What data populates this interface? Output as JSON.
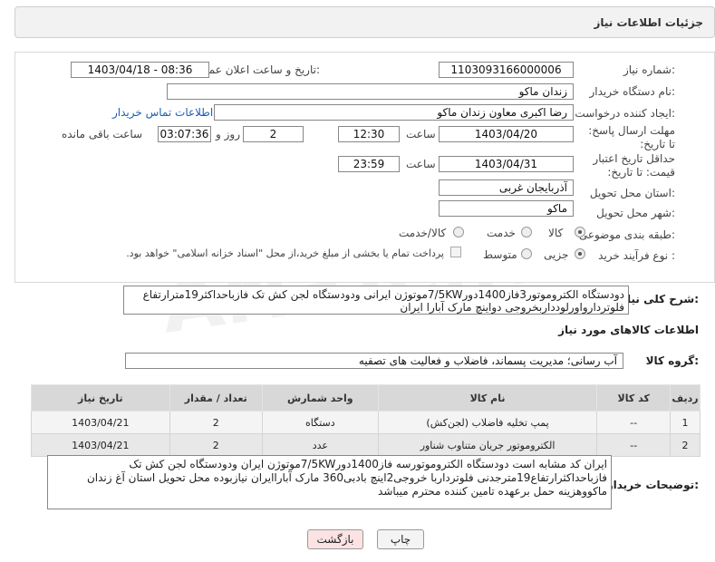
{
  "header": {
    "title": "جزئیات اطلاعات نیاز"
  },
  "watermark": "AriaTender.net",
  "form": {
    "need_number": {
      "label": "شماره نیاز:",
      "value": "1103093166000006"
    },
    "announce_datetime": {
      "label": "تاریخ و ساعت اعلان عمومی:",
      "value": "1403/04/18 - 08:36"
    },
    "buyer_org": {
      "label": "نام دستگاه خریدار:",
      "value": "زندان ماکو"
    },
    "requester": {
      "label": "ایجاد کننده درخواست:",
      "value": "رضا اکبری معاون زندان ماکو",
      "contact_link": "اطلاعات تماس خریدار"
    },
    "deadline": {
      "label": "مهلت ارسال پاسخ: تا تاریخ:",
      "date": "1403/04/20",
      "time_label": "ساعت",
      "time": "12:30",
      "days": "2",
      "days_label": "روز و",
      "remaining": "03:07:36",
      "remaining_label": "ساعت باقی مانده"
    },
    "validity": {
      "label": "حداقل تاریخ اعتبار قیمت: تا تاریخ:",
      "date": "1403/04/31",
      "time_label": "ساعت",
      "time": "23:59"
    },
    "province": {
      "label": "استان محل تحویل:",
      "value": "آذربایجان غربی"
    },
    "city": {
      "label": "شهر محل تحویل:",
      "value": "ماکو"
    },
    "category": {
      "label": "طبقه بندی موضوعی:",
      "options": [
        "کالا",
        "خدمت",
        "کالا/خدمت"
      ],
      "selected": "کالا"
    },
    "purchase_type": {
      "label": "نوع فرآیند خرید :",
      "options": [
        "جزیی",
        "متوسط"
      ],
      "selected": "جزیی",
      "note": "پرداخت تمام یا بخشی از مبلغ خرید،از محل \"اسناد خزانه اسلامی\" خواهد بود."
    }
  },
  "summary": {
    "label": "شرح کلی نیاز:",
    "text": "دودستگاه الکتروموتور3فاز1400دور7/5KWموتوژن ایرانی ودودستگاه لجن کش تک فازباحداکثر19مترارتفاع فلوتردارواورلودداربخروجی دواینچ مارک آبارا ایران"
  },
  "goods_info": {
    "title": "اطلاعات کالاهای مورد نیاز",
    "group_label": "گروه کالا:",
    "group_value": "آب رسانی؛ مدیریت پسماند، فاضلاب و فعالیت های تصفیه"
  },
  "table": {
    "headers": [
      "ردیف",
      "کد کالا",
      "نام کالا",
      "واحد شمارش",
      "تعداد / مقدار",
      "تاریخ نیاز"
    ],
    "rows": [
      [
        "1",
        "--",
        "پمپ تخلیه فاضلاب (لجن‌کش)",
        "دستگاه",
        "2",
        "1403/04/21"
      ],
      [
        "2",
        "--",
        "الکتروموتور جریان متناوب شناور",
        "عدد",
        "2",
        "1403/04/21"
      ]
    ]
  },
  "buyer_notes": {
    "label": "توضیحات خریدار:",
    "text": "ایران کد مشابه است دودستگاه الکتروموتورسه فاز1400دور7/5KWموتوژن ایران ودودستگاه لجن کش تک فازباحداکثرارتفاع19مترجدنی فلوترداربا خروجی2اینچ بادبی360 مارک آباراایران نیازبوده محل تحویل استان آغ زندان ماکووهزینه حمل برعهده تامین کننده محترم میباشد"
  },
  "buttons": {
    "print": "چاپ",
    "back": "بازگشت"
  }
}
